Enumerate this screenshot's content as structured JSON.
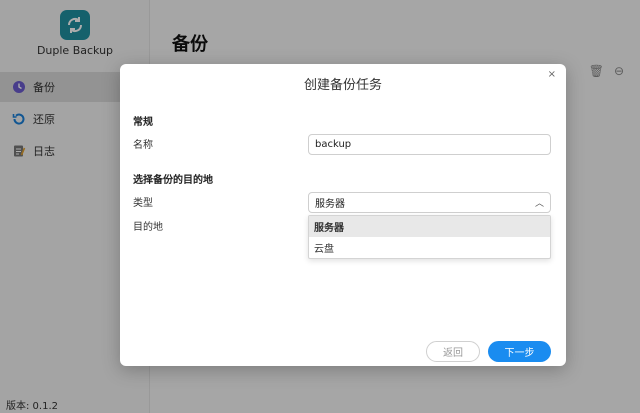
{
  "app": {
    "name": "Duple Backup",
    "page_title": "备份",
    "version": "版本: 0.1.2"
  },
  "sidebar": {
    "items": [
      {
        "label": "备份",
        "icon": "clock-icon",
        "active": true
      },
      {
        "label": "还原",
        "icon": "restore-icon",
        "active": false
      },
      {
        "label": "日志",
        "icon": "log-icon",
        "active": false
      }
    ]
  },
  "dialog": {
    "title": "创建备份任务",
    "close": "×",
    "section_general": "常规",
    "name_label": "名称",
    "name_value": "backup",
    "section_destination": "选择备份的目的地",
    "type_label": "类型",
    "type_value": "服务器",
    "dest_label": "目的地",
    "type_options": [
      "服务器",
      "云盘"
    ],
    "back_label": "返回",
    "next_label": "下一步"
  },
  "colors": {
    "accent": "#1a8cf0",
    "logo": "#1f8fa0"
  }
}
